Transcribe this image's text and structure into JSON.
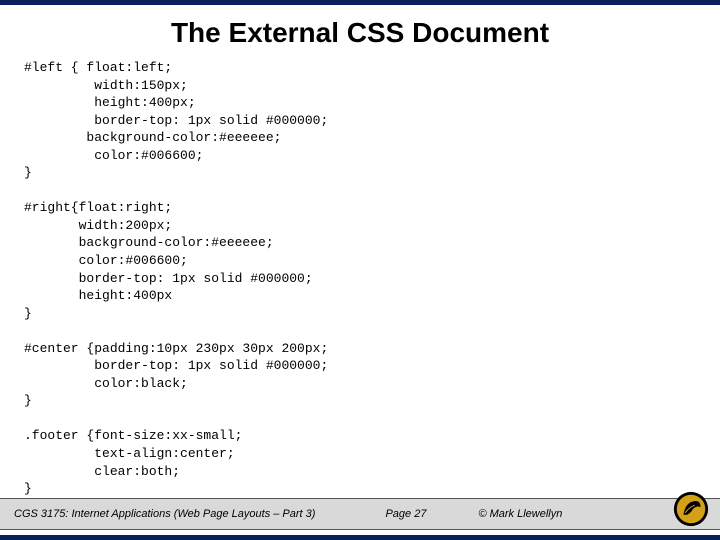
{
  "title": "The External CSS Document",
  "code": {
    "block1_selector": "#left { float:left;",
    "block1_l2": "         width:150px;",
    "block1_l3": "         height:400px;",
    "block1_l4": "         border-top: 1px solid #000000;",
    "block1_l5": "        background-color:#eeeeee;",
    "block1_l6": "         color:#006600;",
    "block1_close": "}",
    "block2_selector": "#right{float:right;",
    "block2_l2": "       width:200px;",
    "block2_l3": "       background-color:#eeeeee;",
    "block2_l4": "       color:#006600;",
    "block2_l5": "       border-top: 1px solid #000000;",
    "block2_l6": "       height:400px",
    "block2_close": "}",
    "block3_selector": "#center {padding:10px 230px 30px 200px;",
    "block3_l2": "         border-top: 1px solid #000000;",
    "block3_l3": "         color:black;",
    "block3_close": "}",
    "block4_selector": ".footer {font-size:xx-small;",
    "block4_l2": "         text-align:center;",
    "block4_l3": "         clear:both;",
    "block4_close": "}"
  },
  "footer": {
    "course": "CGS 3175: Internet Applications (Web Page Layouts – Part 3)",
    "page": "Page 27",
    "copyright": "© Mark Llewellyn"
  },
  "logo_name": "ucf-pegasus-logo",
  "colors": {
    "border_navy": "#0a1f5c",
    "footer_grey": "#d9d9d9",
    "logo_gold": "#d4a017"
  }
}
